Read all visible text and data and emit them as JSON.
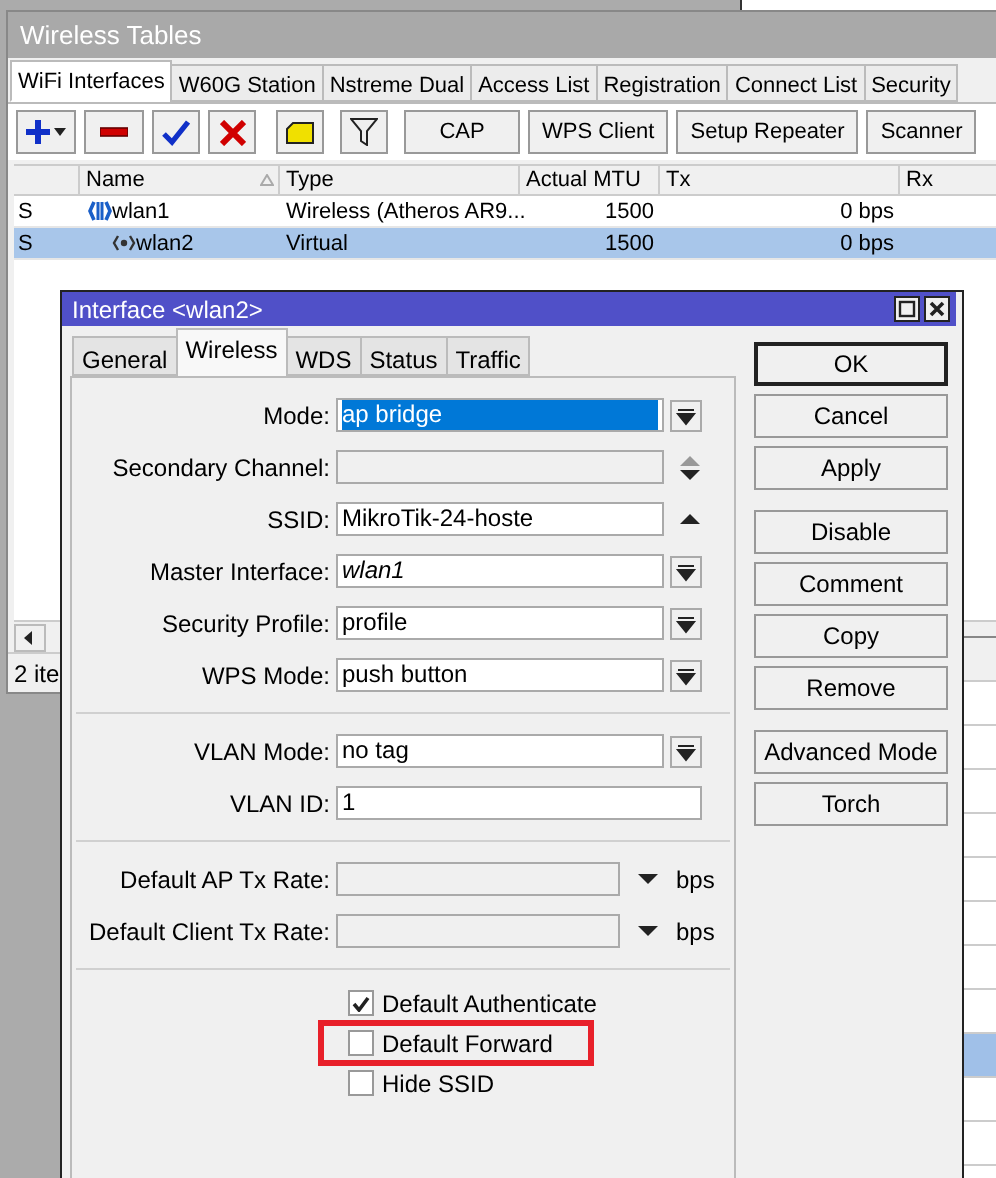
{
  "main_window": {
    "title": "Wireless Tables",
    "tabs": [
      {
        "label": "WiFi Interfaces",
        "selected": true
      },
      {
        "label": "W60G Station",
        "selected": false
      },
      {
        "label": "Nstreme Dual",
        "selected": false
      },
      {
        "label": "Access List",
        "selected": false
      },
      {
        "label": "Registration",
        "selected": false
      },
      {
        "label": "Connect List",
        "selected": false
      },
      {
        "label": "Security",
        "selected": false
      }
    ],
    "toolbar": [
      {
        "kind": "add"
      },
      {
        "kind": "remove"
      },
      {
        "kind": "enable"
      },
      {
        "kind": "disable"
      },
      {
        "kind": "comment"
      },
      {
        "kind": "filter"
      },
      {
        "kind": "text",
        "label": "CAP"
      },
      {
        "kind": "text",
        "label": "WPS Client"
      },
      {
        "kind": "text",
        "label": "Setup Repeater"
      },
      {
        "kind": "text",
        "label": "Scanner"
      }
    ],
    "table": {
      "columns": [
        "Name",
        "Type",
        "Actual MTU",
        "Tx",
        "Rx"
      ],
      "rows": [
        {
          "flag": "S",
          "kind": "wireless",
          "name": "wlan1",
          "type": "Wireless (Atheros AR9...",
          "mtu": "1500",
          "tx": "0 bps",
          "selected": false
        },
        {
          "flag": "S",
          "kind": "virtual",
          "name": "wlan2",
          "type": "Virtual",
          "mtu": "1500",
          "tx": "0 bps",
          "selected": true
        }
      ]
    },
    "status_bar": "2 ite"
  },
  "dialog": {
    "title": "Interface <wlan2>",
    "tabs": [
      {
        "label": "General",
        "selected": false
      },
      {
        "label": "Wireless",
        "selected": true
      },
      {
        "label": "WDS",
        "selected": false
      },
      {
        "label": "Status",
        "selected": false
      },
      {
        "label": "Traffic",
        "selected": false
      }
    ],
    "sections": [
      {
        "fields": [
          {
            "kind": "dropdown",
            "label": "Mode:",
            "value": "ap bridge",
            "selected": true,
            "italic": false
          },
          {
            "kind": "disabled",
            "label": "Secondary Channel:"
          },
          {
            "kind": "combo",
            "label": "SSID:",
            "value": "MikroTik-24-hoste",
            "selected": false,
            "italic": false
          },
          {
            "kind": "dropdown",
            "label": "Master Interface:",
            "value": "wlan1",
            "selected": false,
            "italic": true
          },
          {
            "kind": "dropdown",
            "label": "Security Profile:",
            "value": "profile",
            "selected": false,
            "italic": false
          },
          {
            "kind": "dropdown",
            "label": "WPS Mode:",
            "value": "push button",
            "selected": false,
            "italic": false
          }
        ]
      },
      {
        "fields": [
          {
            "kind": "dropdown",
            "label": "VLAN Mode:",
            "value": "no tag",
            "selected": false,
            "italic": false
          },
          {
            "kind": "text",
            "label": "VLAN ID:",
            "value": "1",
            "selected": false,
            "italic": false
          }
        ]
      },
      {
        "fields": [
          {
            "kind": "rate",
            "label": "Default AP Tx Rate:",
            "unit": "bps"
          },
          {
            "kind": "rate",
            "label": "Default Client Tx Rate:",
            "unit": "bps"
          }
        ]
      }
    ],
    "checkboxes": [
      {
        "label": "Default Authenticate",
        "checked": true,
        "highlighted": false
      },
      {
        "label": "Default Forward",
        "checked": false,
        "highlighted": true
      },
      {
        "label": "Hide SSID",
        "checked": false,
        "highlighted": false
      }
    ],
    "button_groups": [
      [
        {
          "label": "OK",
          "default": true
        },
        {
          "label": "Cancel",
          "default": false
        },
        {
          "label": "Apply",
          "default": false
        }
      ],
      [
        {
          "label": "Disable",
          "default": false
        },
        {
          "label": "Comment",
          "default": false
        },
        {
          "label": "Copy",
          "default": false
        },
        {
          "label": "Remove",
          "default": false
        }
      ],
      [
        {
          "label": "Advanced Mode",
          "default": false
        },
        {
          "label": "Torch",
          "default": false
        }
      ]
    ]
  }
}
